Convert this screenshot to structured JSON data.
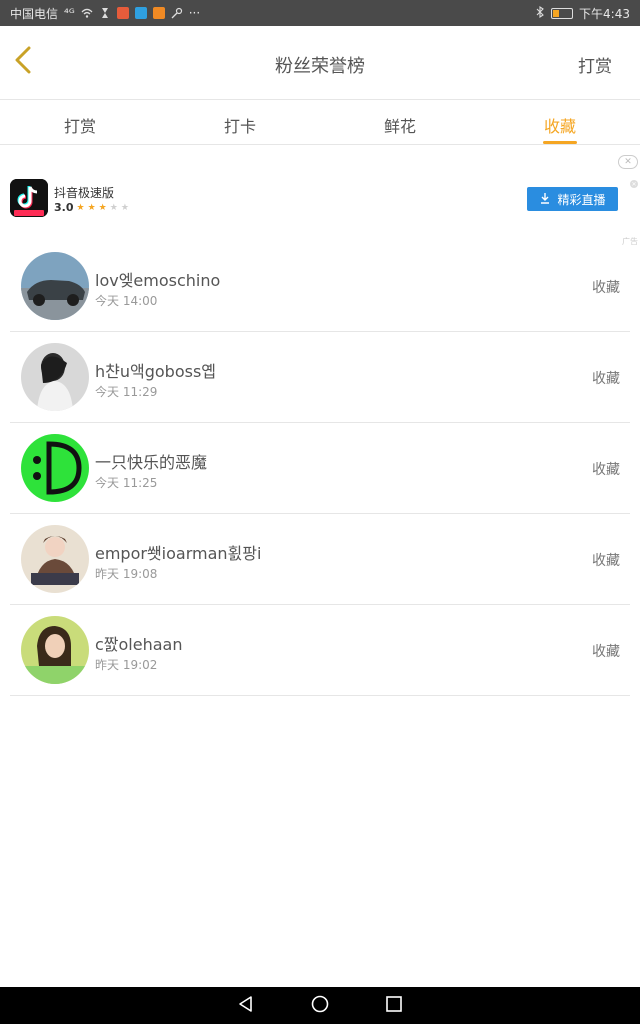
{
  "status_bar": {
    "carrier": "中国电信",
    "signal": "⁴ᴳ",
    "more": "···",
    "time": "下午4:43"
  },
  "header": {
    "title": "粉丝荣誉榜",
    "right_button": "打赏"
  },
  "tabs": [
    {
      "label": "打赏",
      "active": false
    },
    {
      "label": "打卡",
      "active": false
    },
    {
      "label": "鲜花",
      "active": false
    },
    {
      "label": "收藏",
      "active": true
    }
  ],
  "ad": {
    "app_name": "抖音极速版",
    "rating": "3.0",
    "stars_filled": 3,
    "stars_total": 5,
    "button_label": "精彩直播",
    "label": "广告"
  },
  "list": [
    {
      "name": "lov엦emoschino",
      "time": "今天 14:00",
      "action": "收藏"
    },
    {
      "name": "h챤u액goboss옙",
      "time": "今天 11:29",
      "action": "收藏"
    },
    {
      "name": "一只快乐的恶魔",
      "time": "今天 11:25",
      "action": "收藏"
    },
    {
      "name": "empor쐣ioarman횘팡i",
      "time": "昨天 19:08",
      "action": "收藏"
    },
    {
      "name": "c짨olehaan",
      "time": "昨天 19:02",
      "action": "收藏"
    }
  ],
  "colors": {
    "accent": "#f5a623",
    "ad_button": "#2a8de0",
    "status_bar": "#4a4a4a"
  },
  "icons": [
    "back-chevron-icon",
    "download-icon",
    "close-icon",
    "nav-back-icon",
    "nav-home-icon",
    "nav-recents-icon"
  ]
}
